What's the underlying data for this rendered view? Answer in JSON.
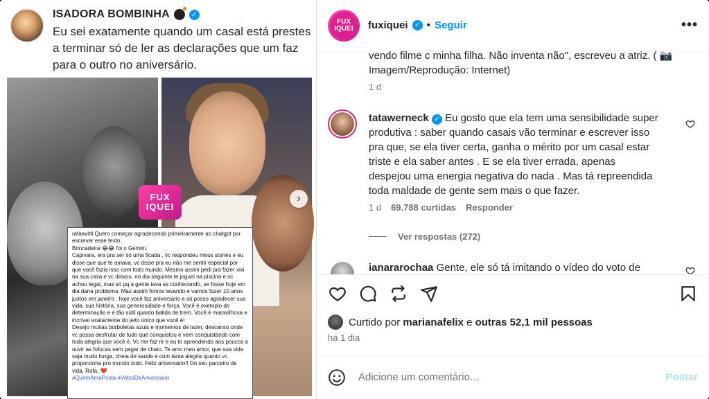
{
  "media": {
    "author_name": "ISADORA BOMBINHA",
    "author_emoji": "bomb-icon",
    "caption": "Eu sei exatamente quando um casal está prestes a terminar só de ler as declarações que um faz para o outro no aniversário.",
    "badge_text": "FUXIQUEI",
    "badge_sub": "fuxiquei",
    "letter": {
      "l1": "rafaavitti Quero começar agradecendo primeiramente ao chatgpt por escrever esse texto.",
      "l2": "Brincadeira 😂😂 foi o Gemini.",
      "l3": "Capivara, era pra ser só uma ficada , vc respondeu meus stories e eu disse que  que te amava, vc disse pra eu não me sentir especial por que você fazia isso com todo mundo. Mesmo assim pedi pra fazer xixi na sua casa e vc deixou, no dia seguinte te joguei na piscina e vc achou legal, mas só pq a gente tava se conhecendo, se fosse hoje em dia daria problema. Mas assim fomos levando e vamos fazer 10 anos juntos em janeiro , hoje você faz aniversário e só posso agradecer sua vida, sua história, sua generosidade e força. Você é exemplo de determinação e é tão sútil quanto batida de trem. Você é maravilhosa e incrível exatamente do jeito único que você é!",
      "l4": "Desejo muitas borboletas azuis e momentos de lazer, descanso onde vc possa desfrutar de tudo que conquistou e vem conquistando com toda alegria que você é. Vc me faz rir e eu to aprendendo aos poucos a ouvir as fofocas sem pagar de chato. Te amo meu amor, que sua vida seja muito longa, cheia de saúde e com tanta alegria quanto vc proporciona pro mundo todo. Feliz aniversário!! Do seu parceiro de vida, Rafa. ❤️",
      "tags": "#QuemAmaPosta #VotosDeAniversario"
    },
    "next_arrow": "›"
  },
  "header": {
    "username": "fuxiquei",
    "separator": "•",
    "follow_label": "Seguir",
    "more_label": "•••",
    "avatar_text": "FUXIQUEI"
  },
  "previous_comment": {
    "text": "vendo filme c minha filha. Não inventa não\", escreveu a atriz. ( 📷 Imagem/Reprodução: Internet)",
    "time": "1 d"
  },
  "comments": [
    {
      "user": "tatawerneck",
      "text": "Eu gosto que ela tem uma sensibilidade super produtiva : saber quando casais vão terminar e escrever isso pra que, se ela tiver certa, ganha o mérito por um casal estar triste e ela saber antes . E se ela tiver errada, apenas despejou uma energia negativa do nada . Mas tá repreendida toda maldade de gente sem mais o que fazer.",
      "time": "1 d",
      "likes": "69.788 curtidas",
      "reply_label": "Responder",
      "view_replies": "Ver respostas (272)"
    },
    {
      "user": "ianararochaa",
      "text": "Gente, ele só tá imitando o vídeo do voto de"
    }
  ],
  "likes": {
    "prefix": "Curtido por",
    "user": "marianafelix",
    "middle": "e",
    "others": "outras 52,1 mil pessoas"
  },
  "posted_time": "há 1 dia",
  "add_comment": {
    "placeholder": "Adicione um comentário...",
    "post_label": "Postar"
  },
  "colors": {
    "accent": "#0095f6",
    "brand_pink": "#e0208f",
    "post_disabled": "#b2dffc"
  }
}
